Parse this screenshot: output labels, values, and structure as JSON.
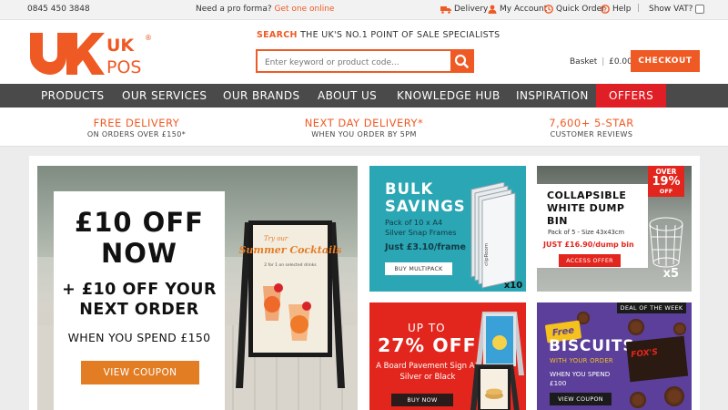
{
  "topbar": {
    "phone": "0845 450 3848",
    "proforma_text": "Need a pro forma?",
    "proforma_link": "Get one online",
    "links": [
      "Delivery",
      "My Account",
      "Quick Order",
      "Help"
    ],
    "separator": "|",
    "vat_label": "Show VAT?"
  },
  "header": {
    "logo_uk": "UK",
    "logo_pos": "POS",
    "logo_reg": "®",
    "tagline_highlight": "SEARCH",
    "tagline_rest": "THE UK'S NO.1 POINT OF SALE SPECIALISTS",
    "search_placeholder": "Enter keyword or product code...",
    "basket_label": "Basket",
    "basket_amount": "£0.00",
    "checkout_label": "CHECKOUT"
  },
  "nav": {
    "items": [
      "PRODUCTS",
      "OUR SERVICES",
      "OUR BRANDS",
      "ABOUT US",
      "KNOWLEDGE HUB",
      "INSPIRATION",
      "OFFERS"
    ]
  },
  "benefits": [
    {
      "title": "FREE DELIVERY",
      "subtitle": "ON ORDERS OVER £150*"
    },
    {
      "title": "NEXT DAY DELIVERY*",
      "subtitle": "WHEN YOU ORDER BY 5PM"
    },
    {
      "title": "7,600+ 5-STAR",
      "subtitle": "CUSTOMER REVIEWS"
    }
  ],
  "hero": {
    "line1": "£10 OFF NOW",
    "line2": "+ £10 OFF YOUR NEXT ORDER",
    "line3": "WHEN YOU SPEND £150",
    "button": "VIEW COUPON",
    "poster_top": "Try our",
    "poster_title": "Summer Cocktails",
    "poster_sub": "2 for 1 on selected drinks"
  },
  "tiles": {
    "bulk": {
      "title": "BULK SAVINGS",
      "subtitle": "Pack of 10 x A4 Silver Snap Frames",
      "price": "Just £3.10/frame",
      "button": "BUY MULTIPACK",
      "badge": "x10",
      "frame_label": "clipRoom"
    },
    "dump": {
      "title": "COLLAPSIBLE WHITE DUMP BIN",
      "subtitle": "Pack of 5 - Size 43x43cm",
      "price": "JUST £16.90/dump bin",
      "button": "ACCESS OFFER",
      "over_top": "OVER",
      "over_pct": "19%",
      "over_off": "OFF",
      "badge": "x5"
    },
    "board": {
      "upto": "UP TO",
      "pct": "27% OFF",
      "subtitle": "A Board Pavement Sign A1 Silver or Black",
      "button": "BUY NOW"
    },
    "biscuits": {
      "deal": "DEAL OF THE WEEK",
      "free": "Free",
      "title": "BISCUITS",
      "subtitle": "WITH YOUR ORDER",
      "subtitle2": "WHEN YOU SPEND £100",
      "button": "VIEW COUPON",
      "pack_label": "FOX'S"
    }
  },
  "colors": {
    "brand_orange": "#ef5a24",
    "nav_gray": "#4a4a4a",
    "offers_red": "#e01e26",
    "bulk_teal": "#2aa6b4",
    "biscuit_purple": "#5b3f9a",
    "coupon_orange": "#e37d24"
  }
}
